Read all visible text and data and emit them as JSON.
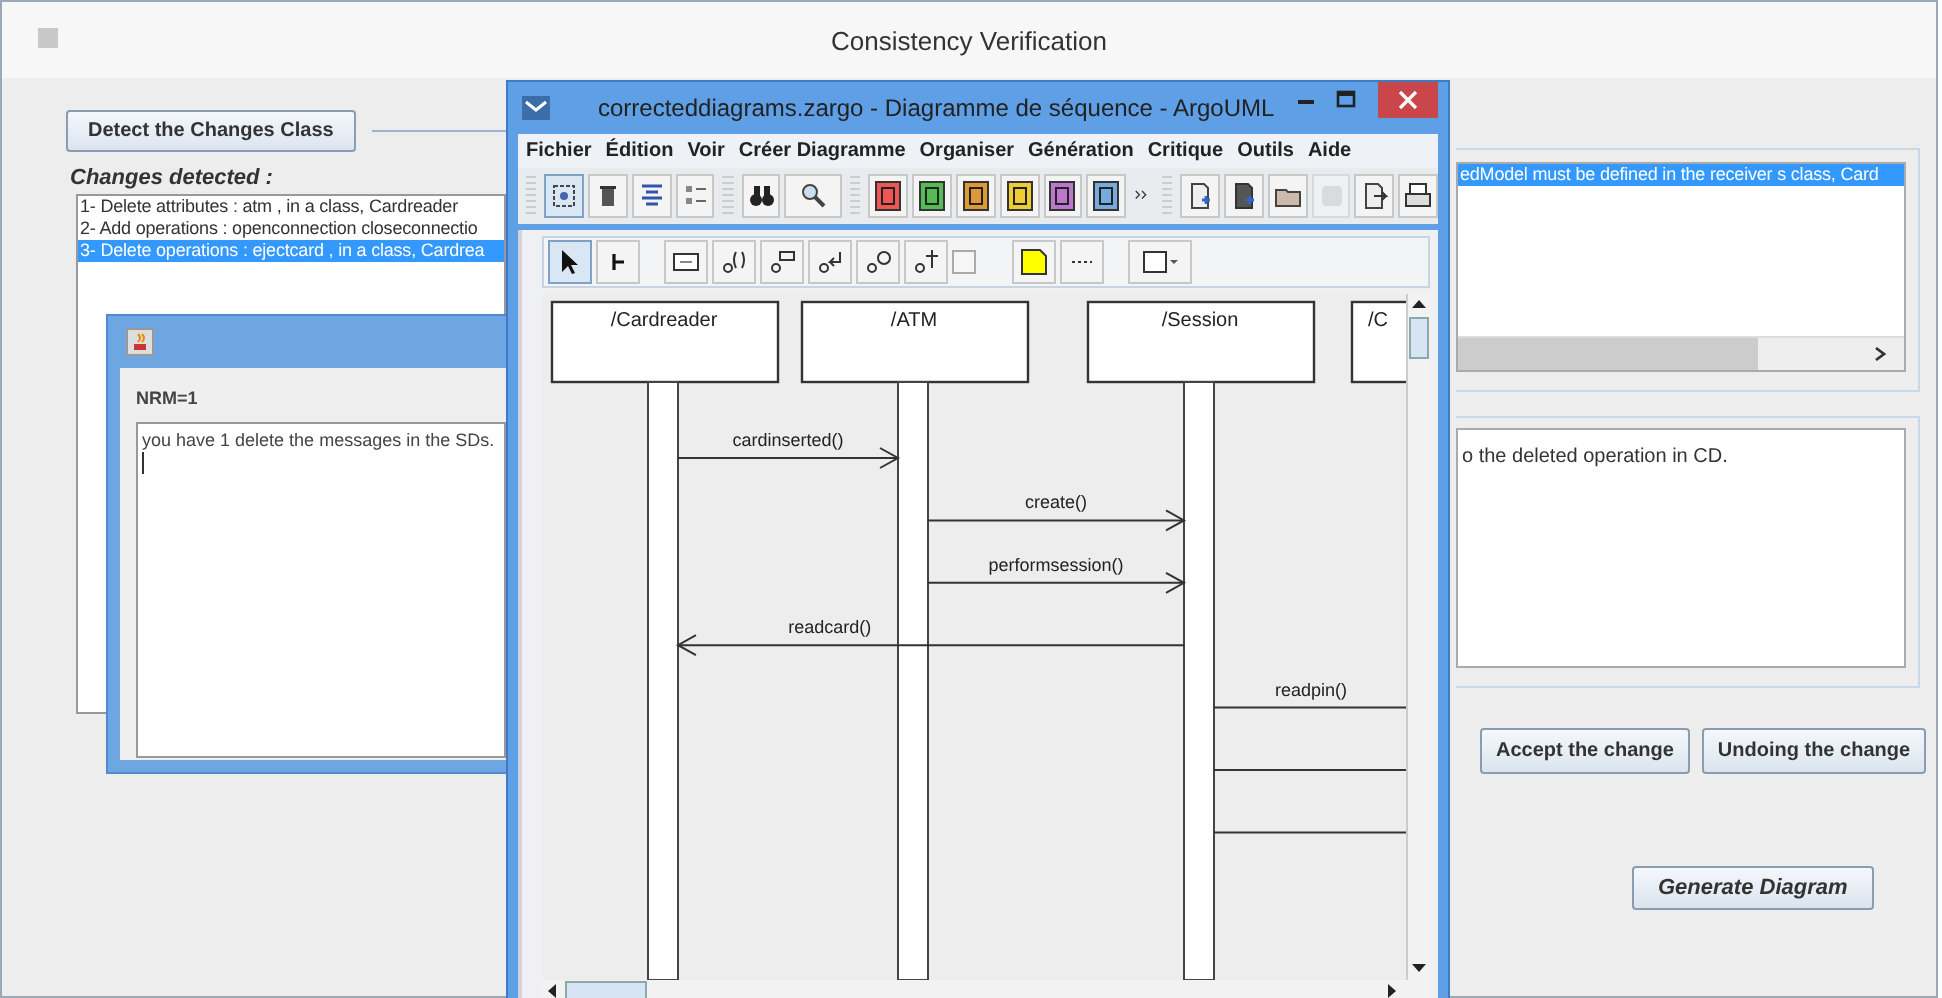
{
  "main_window": {
    "title": "Consistency Verification",
    "detect_button": "Detect the Changes Class",
    "changes": {
      "title": "Changes detected :",
      "items": [
        {
          "text": "1- Delete attributes : atm , in a class, Cardreader",
          "selected": false
        },
        {
          "text": "2- Add operations : openconnection closeconnectio",
          "selected": false
        },
        {
          "text": "3- Delete operations : ejectcard , in a class, Cardrea",
          "selected": true
        }
      ]
    },
    "rules_list": {
      "items": [
        {
          "text": "edModel must be defined in the receiver s class, Card",
          "selected": true
        }
      ]
    },
    "solution": {
      "text": "o the deleted operation in CD."
    },
    "actions": [
      "Accept the change",
      "Undoing the change"
    ],
    "generate_button": "Generate Diagram"
  },
  "dialog": {
    "label": "NRM=1",
    "text": "you have 1 delete the messages in the SDs."
  },
  "argouml": {
    "title": "correcteddiagrams.zargo - Diagramme de séquence - ArgoUML",
    "menu": [
      "Fichier",
      "Édition",
      "Voir",
      "Créer Diagramme",
      "Organiser",
      "Génération",
      "Critique",
      "Outils",
      "Aide"
    ],
    "lifelines": [
      "/Cardreader",
      "/ATM",
      "/Session",
      "/C"
    ],
    "messages": [
      {
        "kind": "call",
        "label": "cardinserted()"
      },
      {
        "kind": "call",
        "label": "create()"
      },
      {
        "kind": "call",
        "label": "performsession()"
      },
      {
        "kind": "call",
        "label": "readcard()"
      },
      {
        "kind": "call",
        "label": "readpin()"
      },
      {
        "kind": "call"
      },
      {
        "kind": "call"
      }
    ]
  }
}
